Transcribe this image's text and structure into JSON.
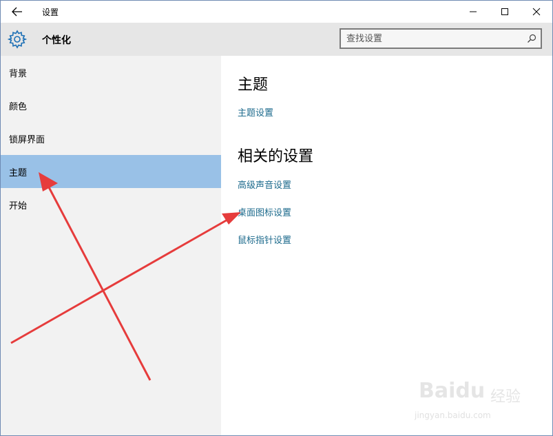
{
  "window": {
    "title": "设置"
  },
  "header": {
    "section_title": "个性化"
  },
  "search": {
    "placeholder": "查找设置"
  },
  "sidebar": {
    "items": [
      {
        "label": "背景"
      },
      {
        "label": "颜色"
      },
      {
        "label": "锁屏界面"
      },
      {
        "label": "主题",
        "selected": true
      },
      {
        "label": "开始"
      }
    ]
  },
  "content": {
    "theme_heading": "主题",
    "theme_settings_link": "主题设置",
    "related_heading": "相关的设置",
    "related_links": [
      {
        "label": "高级声音设置"
      },
      {
        "label": "桌面图标设置"
      },
      {
        "label": "鼠标指针设置"
      }
    ]
  },
  "watermark": {
    "brand": "Baidu",
    "cn": "经验",
    "url": "jingyan.baidu.com"
  },
  "colors": {
    "selected_item": "#99c1e7",
    "link": "#1c6a8c",
    "sidebar_bg": "#f2f2f2",
    "header_bg": "#e6e6e6",
    "annotation_arrow": "#e63c3c"
  },
  "icons": {
    "back": "arrow-left-icon",
    "settings": "gear-icon",
    "search": "search-icon",
    "minimize": "minimize-icon",
    "maximize": "maximize-icon",
    "close": "close-icon"
  }
}
